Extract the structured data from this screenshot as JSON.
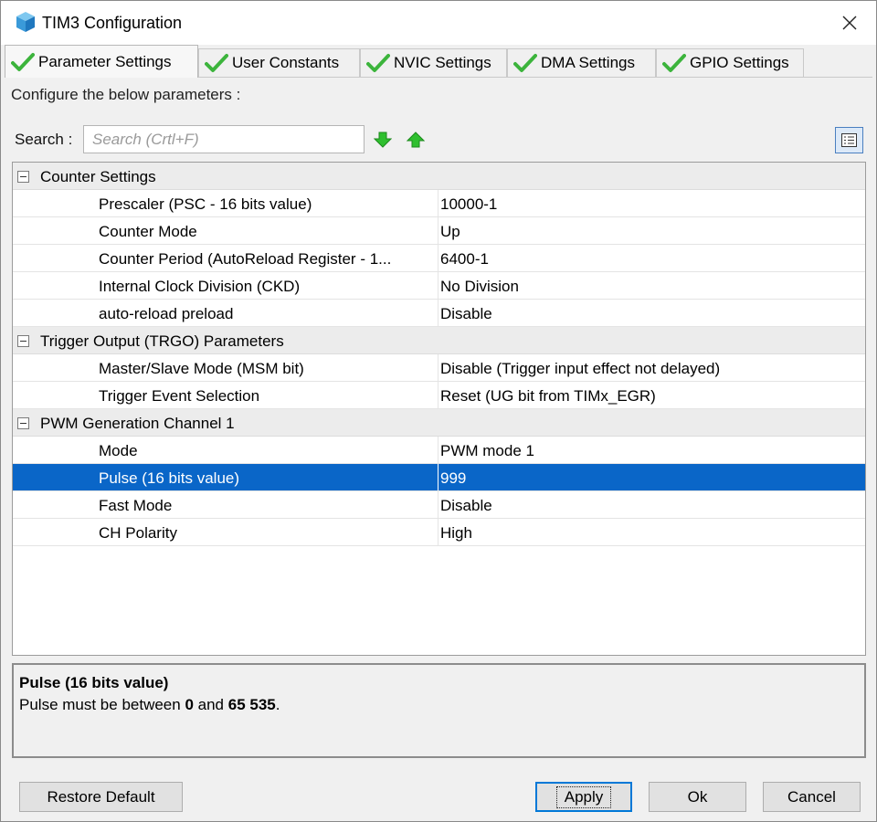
{
  "window": {
    "title": "TIM3 Configuration",
    "icon": "cube-icon",
    "close_icon": "close-icon"
  },
  "tabs": [
    {
      "label": "Parameter Settings",
      "active": true,
      "icon": "check-icon"
    },
    {
      "label": "User Constants",
      "active": false,
      "icon": "check-icon"
    },
    {
      "label": "NVIC Settings",
      "active": false,
      "icon": "check-icon"
    },
    {
      "label": "DMA Settings",
      "active": false,
      "icon": "check-icon"
    },
    {
      "label": "GPIO Settings",
      "active": false,
      "icon": "check-icon"
    }
  ],
  "configure_label": "Configure the below parameters :",
  "search": {
    "label": "Search :",
    "placeholder": "Search (Crtl+F)",
    "value": ""
  },
  "groups": [
    {
      "label": "Counter Settings",
      "expanded": true,
      "params": [
        {
          "name": "Prescaler (PSC - 16 bits value)",
          "value": "10000-1"
        },
        {
          "name": "Counter Mode",
          "value": "Up"
        },
        {
          "name": "Counter Period (AutoReload Register - 1...",
          "value": "6400-1"
        },
        {
          "name": "Internal Clock Division (CKD)",
          "value": "No Division"
        },
        {
          "name": "auto-reload preload",
          "value": "Disable"
        }
      ]
    },
    {
      "label": "Trigger Output (TRGO) Parameters",
      "expanded": true,
      "params": [
        {
          "name": "Master/Slave Mode (MSM bit)",
          "value": "Disable (Trigger input effect not delayed)"
        },
        {
          "name": "Trigger Event Selection",
          "value": "Reset (UG bit from TIMx_EGR)"
        }
      ]
    },
    {
      "label": "PWM Generation Channel 1",
      "expanded": true,
      "params": [
        {
          "name": "Mode",
          "value": "PWM mode 1"
        },
        {
          "name": "Pulse (16 bits value)",
          "value": "999",
          "selected": true
        },
        {
          "name": "Fast Mode",
          "value": "Disable"
        },
        {
          "name": "CH Polarity",
          "value": "High"
        }
      ]
    }
  ],
  "description": {
    "title": "Pulse (16 bits value)",
    "prefix": "Pulse must be between ",
    "min": "0",
    "middle": " and ",
    "max": "65 535",
    "suffix": "."
  },
  "buttons": {
    "restore": "Restore Default",
    "apply": "Apply",
    "ok": "Ok",
    "cancel": "Cancel"
  },
  "colors": {
    "selection": "#0a66c8",
    "check": "#3cb43c",
    "arrow": "#2fbf2f"
  }
}
